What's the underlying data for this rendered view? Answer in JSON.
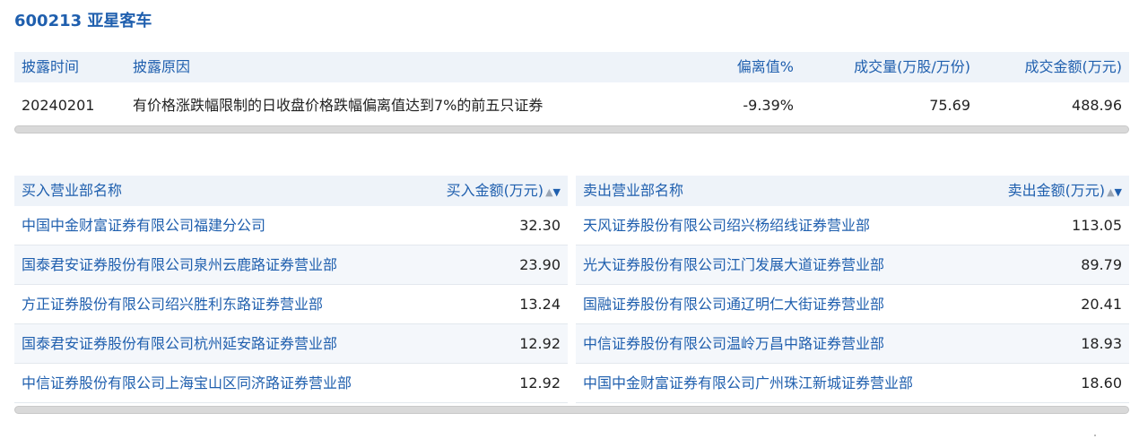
{
  "page": {
    "title": "600213 亚星客车"
  },
  "disclosure": {
    "headers": [
      "披露时间",
      "披露原因",
      "偏离值%",
      "成交量(万股/万份)",
      "成交金额(万元)"
    ],
    "rows": [
      [
        "20240201",
        "有价格涨跌幅限制的日收盘价格跌幅偏离值达到7%的前五只证券",
        "-9.39%",
        "75.69",
        "488.96"
      ]
    ]
  },
  "buy": {
    "header_name": "买入营业部名称",
    "header_amount": "买入金额(万元)",
    "rows": [
      {
        "name": "中国中金财富证券有限公司福建分公司",
        "amount": "32.30"
      },
      {
        "name": "国泰君安证券股份有限公司泉州云鹿路证券营业部",
        "amount": "23.90"
      },
      {
        "name": "方正证券股份有限公司绍兴胜利东路证券营业部",
        "amount": "13.24"
      },
      {
        "name": "国泰君安证券股份有限公司杭州延安路证券营业部",
        "amount": "12.92"
      },
      {
        "name": "中信证券股份有限公司上海宝山区同济路证券营业部",
        "amount": "12.92"
      }
    ]
  },
  "sell": {
    "header_name": "卖出营业部名称",
    "header_amount": "卖出金额(万元)",
    "rows": [
      {
        "name": "天风证券股份有限公司绍兴杨绍线证券营业部",
        "amount": "113.05"
      },
      {
        "name": "光大证券股份有限公司江门发展大道证券营业部",
        "amount": "89.79"
      },
      {
        "name": "国融证券股份有限公司通辽明仁大街证券营业部",
        "amount": "20.41"
      },
      {
        "name": "中信证券股份有限公司温岭万昌中路证券营业部",
        "amount": "18.93"
      },
      {
        "name": "中国中金财富证券有限公司广州珠江新城证券营业部",
        "amount": "18.60"
      }
    ]
  },
  "sort_icons": {
    "up": "▲",
    "down": "▼"
  },
  "colors": {
    "accent": "#1f5fae",
    "header_bg": "#eef3f9",
    "alt_row": "#f4f7fb"
  }
}
